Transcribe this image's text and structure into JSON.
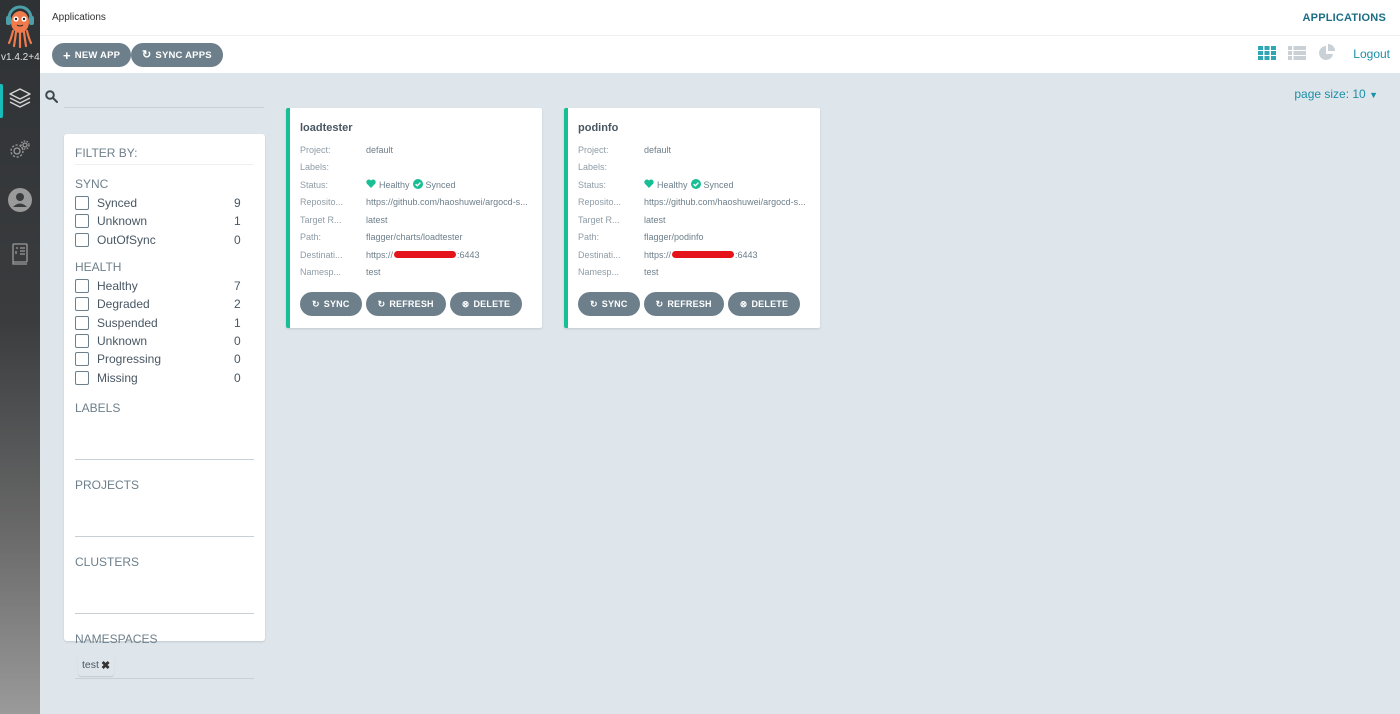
{
  "nav": {
    "version": "v1.4.2+4",
    "items": [
      {
        "name": "applications",
        "icon": "layers-icon",
        "active": true
      },
      {
        "name": "settings",
        "icon": "gears-icon",
        "active": false
      },
      {
        "name": "user-info",
        "icon": "user-circle-icon",
        "active": false
      },
      {
        "name": "docs",
        "icon": "book-icon",
        "active": false
      }
    ]
  },
  "topbar": {
    "title": "Applications",
    "section": "APPLICATIONS"
  },
  "toolbar": {
    "new_app": "NEW APP",
    "sync_apps": "SYNC APPS",
    "views": [
      "tiles-view",
      "list-view",
      "summary-view"
    ],
    "active_view": "tiles-view",
    "logout": "Logout"
  },
  "search": {
    "value": "",
    "placeholder": ""
  },
  "page_size": "page size: 10",
  "filters": {
    "heading": "FILTER BY:",
    "sync": {
      "title": "SYNC",
      "options": [
        {
          "label": "Synced",
          "count": "9"
        },
        {
          "label": "Unknown",
          "count": "1"
        },
        {
          "label": "OutOfSync",
          "count": "0"
        }
      ]
    },
    "health": {
      "title": "HEALTH",
      "options": [
        {
          "label": "Healthy",
          "count": "7"
        },
        {
          "label": "Degraded",
          "count": "2"
        },
        {
          "label": "Suspended",
          "count": "1"
        },
        {
          "label": "Unknown",
          "count": "0"
        },
        {
          "label": "Progressing",
          "count": "0"
        },
        {
          "label": "Missing",
          "count": "0"
        }
      ]
    },
    "labels": "LABELS",
    "projects": "PROJECTS",
    "clusters": "CLUSTERS",
    "namespaces": "NAMESPACES",
    "namespace_tags": [
      "test"
    ]
  },
  "labels": {
    "project": "Project:",
    "labels": "Labels:",
    "status": "Status:",
    "repository": "Reposito...",
    "target": "Target R...",
    "path": "Path:",
    "destination": "Destinati...",
    "namespace": "Namesp..."
  },
  "colors": {
    "healthy": "#18be94",
    "accent": "#1b8fa6",
    "button": "#6d7f8b"
  },
  "apps": [
    {
      "name": "loadtester",
      "project": "default",
      "labels": "",
      "health": "Healthy",
      "sync": "Synced",
      "repository": "https://github.com/haoshuwei/argocd-s...",
      "target": "latest",
      "path": "flagger/charts/loadtester",
      "destination_prefix": "https://",
      "destination_suffix": ":6443",
      "namespace": "test",
      "actions": {
        "sync": "SYNC",
        "refresh": "REFRESH",
        "delete": "DELETE"
      }
    },
    {
      "name": "podinfo",
      "project": "default",
      "labels": "",
      "health": "Healthy",
      "sync": "Synced",
      "repository": "https://github.com/haoshuwei/argocd-s...",
      "target": "latest",
      "path": "flagger/podinfo",
      "destination_prefix": "https://",
      "destination_suffix": ":6443",
      "namespace": "test",
      "actions": {
        "sync": "SYNC",
        "refresh": "REFRESH",
        "delete": "DELETE"
      }
    }
  ]
}
